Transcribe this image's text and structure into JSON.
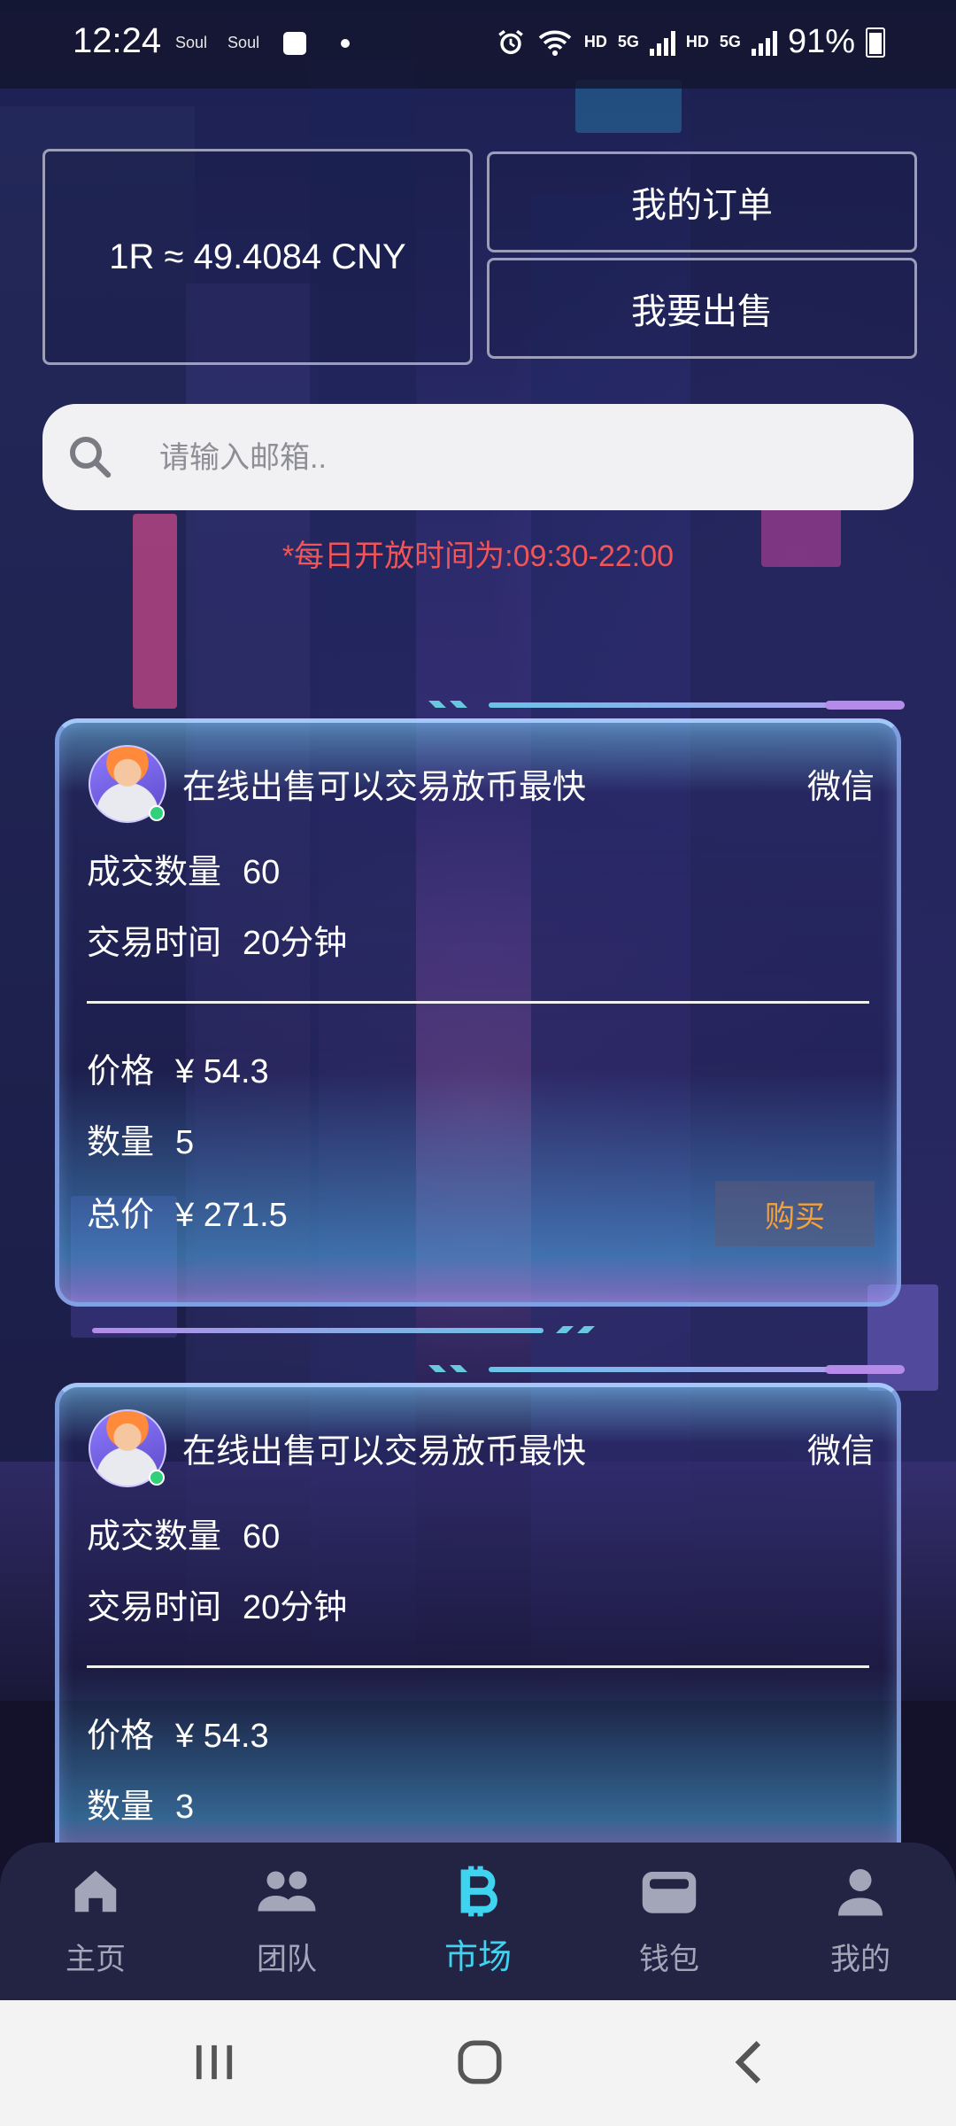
{
  "status_bar": {
    "time": "12:24",
    "apps": [
      "Soul",
      "Soul"
    ],
    "network_labels": [
      "HD",
      "5G",
      "HD",
      "5G"
    ],
    "battery": "91%"
  },
  "rate": "1R ≈ 49.4084 CNY",
  "buttons": {
    "my_orders": "我的订单",
    "i_want_to_sell": "我要出售"
  },
  "search": {
    "placeholder": "请输入邮箱..",
    "value": ""
  },
  "notice": "*每日开放时间为:09:30-22:00",
  "listings": [
    {
      "title": "在线出售可以交易放币最快",
      "payment": "微信",
      "deals_label": "成交数量",
      "deals_value": "60",
      "time_label": "交易时间",
      "time_value": "20分钟",
      "price_label": "价格",
      "price_value": "¥ 54.3",
      "qty_label": "数量",
      "qty_value": "5",
      "total_label": "总价",
      "total_value": "¥ 271.5",
      "buy_label": "购买"
    },
    {
      "title": "在线出售可以交易放币最快",
      "payment": "微信",
      "deals_label": "成交数量",
      "deals_value": "60",
      "time_label": "交易时间",
      "time_value": "20分钟",
      "price_label": "价格",
      "price_value": "¥ 54.3",
      "qty_label": "数量",
      "qty_value": "3"
    }
  ],
  "nav": [
    {
      "label": "主页",
      "icon": "home-icon",
      "active": false
    },
    {
      "label": "团队",
      "icon": "team-icon",
      "active": false
    },
    {
      "label": "市场",
      "icon": "bitcoin-icon",
      "active": true
    },
    {
      "label": "钱包",
      "icon": "wallet-icon",
      "active": false
    },
    {
      "label": "我的",
      "icon": "person-icon",
      "active": false
    }
  ],
  "colors": {
    "accent": "#3fd3ef",
    "notice": "#f0555a",
    "buy": "#f2a13a"
  }
}
